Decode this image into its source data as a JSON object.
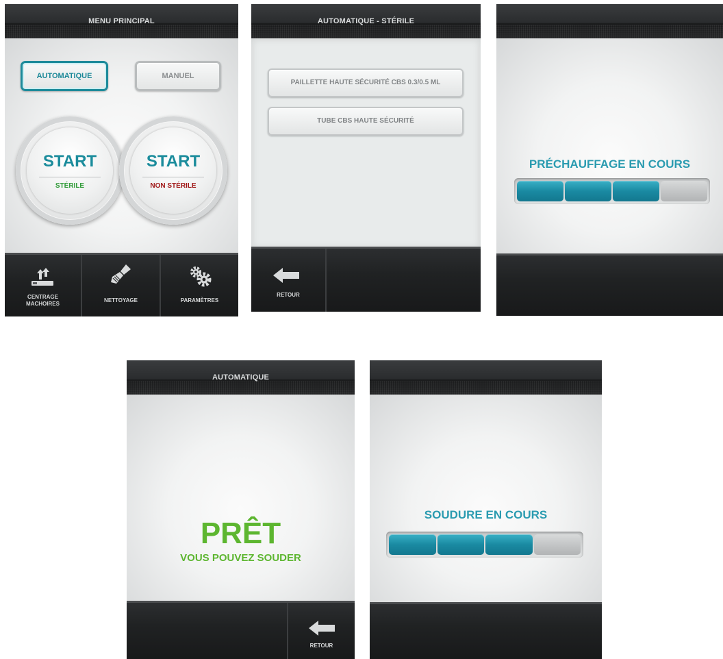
{
  "screen1": {
    "title": "MENU PRINCIPAL",
    "modes": {
      "auto": "AUTOMATIQUE",
      "manual": "MANUEL"
    },
    "start_sterile": {
      "word": "START",
      "sub": "STÉRILE",
      "sub_color": "#2e9a36"
    },
    "start_nonsterile": {
      "word": "START",
      "sub": "NON STÉRILE",
      "sub_color": "#a01818"
    },
    "toolbar": {
      "centrage_line1": "CENTRAGE",
      "centrage_line2": "MACHOIRES",
      "nettoyage": "NETTOYAGE",
      "parametres": "PARAMÈTRES"
    },
    "icons": [
      "jaw-centering-icon",
      "brush-icon",
      "gears-icon"
    ]
  },
  "screen2": {
    "title": "AUTOMATIQUE - STÉRILE",
    "options": [
      "PAILLETTE HAUTE SÉCURITÉ CBS 0.3/0.5 ML",
      "TUBE CBS HAUTE SÉCURITÉ"
    ],
    "back_label": "RETOUR",
    "icon": "back-arrow-icon"
  },
  "screen3": {
    "title": "",
    "status": "PRÉCHAUFFAGE EN COURS",
    "progress": {
      "filled": 3,
      "total": 4
    }
  },
  "screen4": {
    "title": "AUTOMATIQUE",
    "ready": "PRÊT",
    "ready_sub": "VOUS POUVEZ SOUDER",
    "back_label": "RETOUR",
    "icon": "back-arrow-icon"
  },
  "screen5": {
    "title": "",
    "status": "SOUDURE EN COURS",
    "progress": {
      "filled": 3,
      "total": 4
    }
  },
  "colors": {
    "accent_teal": "#1b8c9c",
    "ready_green": "#5db630",
    "status_teal": "#2a9bb0"
  }
}
